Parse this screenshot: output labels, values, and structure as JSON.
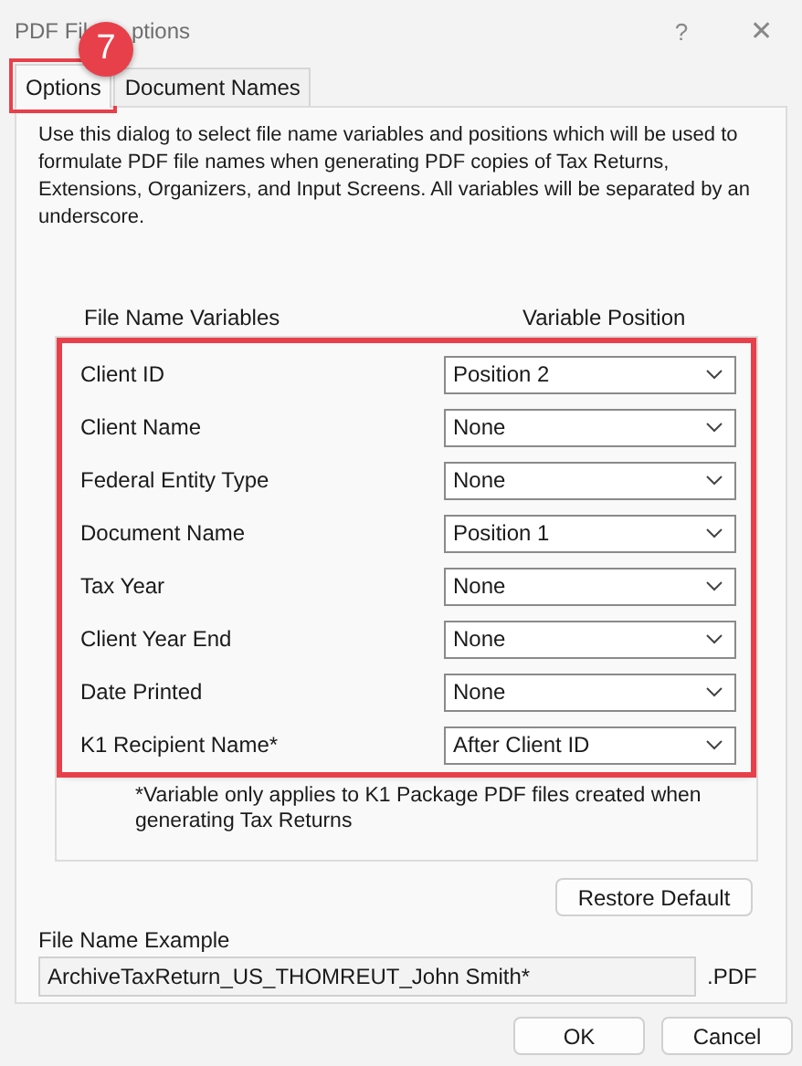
{
  "window": {
    "title_parts": [
      "PDF Fil",
      "ptions"
    ],
    "buttons": [
      {
        "kind": "help",
        "label": "?"
      },
      {
        "kind": "close",
        "label": "✕"
      }
    ]
  },
  "step_badge": {
    "label": "7"
  },
  "tabs": [
    {
      "label": "Options",
      "selected": true,
      "highlighted": true
    },
    {
      "label": "Document Names",
      "selected": false,
      "highlighted": false
    }
  ],
  "description": "Use this dialog to select file name variables and positions which will be used to formulate PDF file names when generating PDF copies of Tax Returns, Extensions, Organizers, and Input Screens.  All variables will be separated by an underscore.",
  "variables": {
    "column_headers": [
      "File Name Variables",
      "Variable Position"
    ],
    "highlighted": true,
    "rows": [
      {
        "name": "Client ID",
        "position": "Position 2"
      },
      {
        "name": "Client Name",
        "position": "None"
      },
      {
        "name": "Federal Entity Type",
        "position": "None"
      },
      {
        "name": "Document Name",
        "position": "Position 1"
      },
      {
        "name": "Tax Year",
        "position": "None"
      },
      {
        "name": "Client Year End",
        "position": "None"
      },
      {
        "name": "Date Printed",
        "position": "None"
      },
      {
        "name": "K1 Recipient Name*",
        "position": "After Client ID"
      }
    ],
    "footnote": "*Variable only applies to K1 Package PDF files created when generating Tax Returns"
  },
  "restore_button": "Restore Default",
  "example": {
    "label": "File Name Example",
    "value": "ArchiveTaxReturn_US_THOMREUT_John Smith*",
    "extension": ".PDF"
  },
  "buttons": [
    "OK",
    "Cancel"
  ]
}
